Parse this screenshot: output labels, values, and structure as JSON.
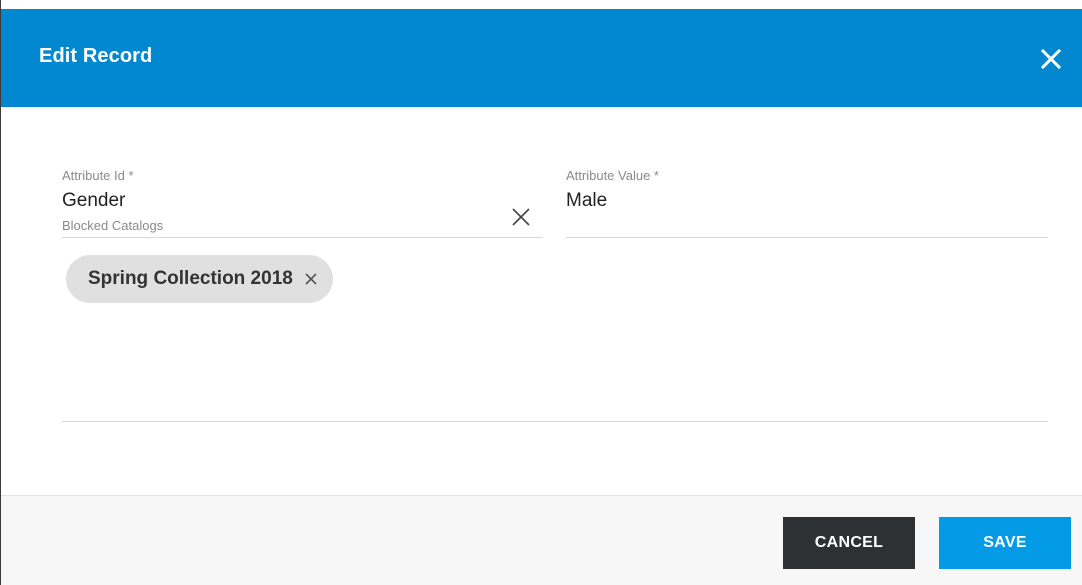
{
  "dialog": {
    "title": "Edit Record",
    "header_color": "#0288d1",
    "close_icon": "close-icon"
  },
  "form": {
    "attribute_id": {
      "label": "Attribute Id *",
      "value": "Gender",
      "clear_icon": "clear-icon"
    },
    "attribute_value": {
      "label": "Attribute Value *",
      "value": "Male"
    },
    "blocked_catalogs": {
      "label": "Blocked Catalogs",
      "chips": [
        {
          "label": "Spring Collection 2018",
          "remove_icon": "close-icon"
        }
      ]
    }
  },
  "footer": {
    "cancel_label": "CANCEL",
    "save_label": "SAVE",
    "cancel_color": "#2e3134",
    "save_color": "#039be5"
  }
}
